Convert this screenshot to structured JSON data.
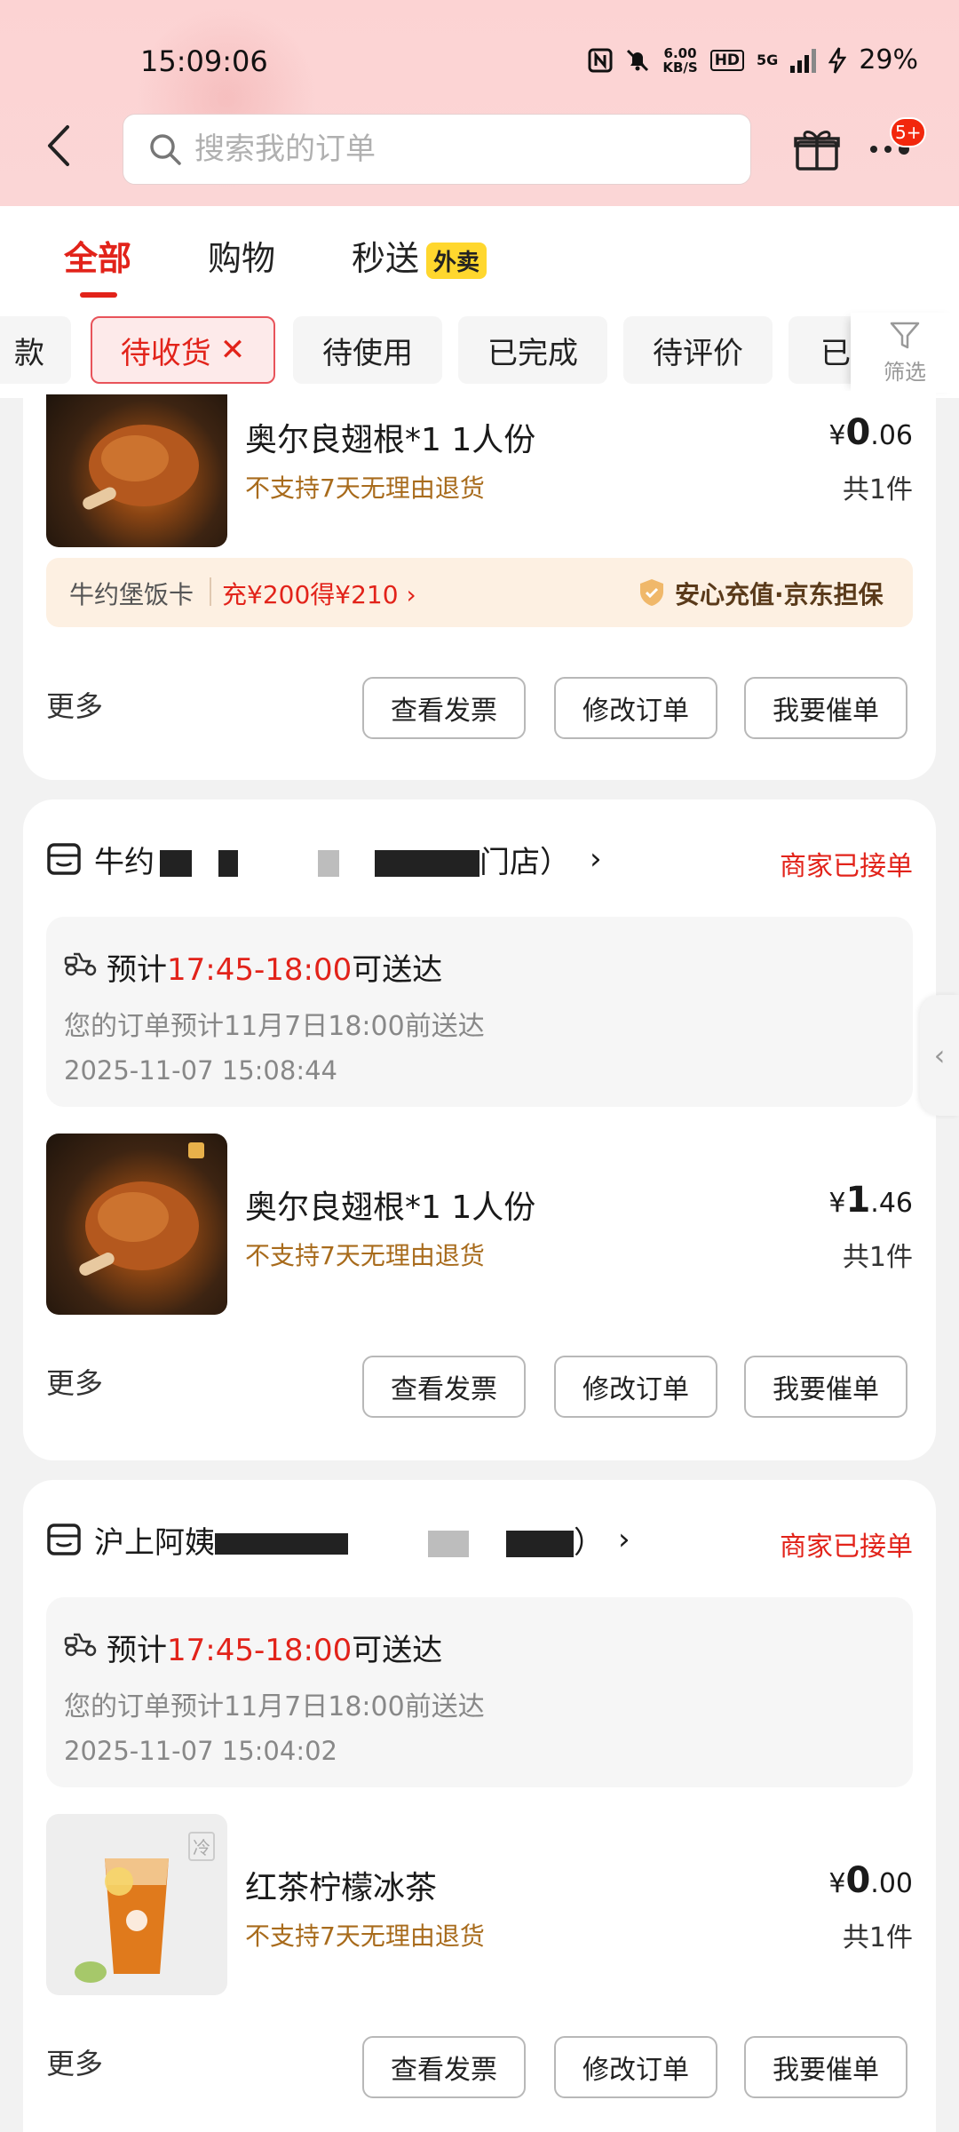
{
  "status_bar": {
    "time": "15:09:06",
    "net_speed_value": "6.00",
    "net_speed_unit": "KB/S",
    "hd": "HD",
    "network": "5G",
    "battery": "29%"
  },
  "header": {
    "search_placeholder": "搜索我的订单",
    "badge": "5+"
  },
  "main_tabs": [
    {
      "label": "全部",
      "active": true
    },
    {
      "label": "购物"
    },
    {
      "label": "秒送",
      "tag": "外卖"
    }
  ],
  "chips": [
    {
      "label": "款"
    },
    {
      "label": "待收货",
      "active": true,
      "close": "✕"
    },
    {
      "label": "待使用"
    },
    {
      "label": "已完成"
    },
    {
      "label": "待评价"
    },
    {
      "label": "已"
    }
  ],
  "filter_label": "筛选",
  "common": {
    "more": "更多",
    "view_invoice": "查看发票",
    "modify_order": "修改订单",
    "urge_order": "我要催单",
    "no_return": "不支持7天无理由退货",
    "count": "共1件",
    "currency": "¥"
  },
  "order1": {
    "item_name": "奥尔良翅根*1 1人份",
    "price_int": "0",
    "price_dec": ".06",
    "promo_card": "牛约堡饭卡",
    "promo_offer": "充¥200得¥210",
    "promo_guarantee": "安心充值·京东担保"
  },
  "order2": {
    "store_prefix": "牛约",
    "store_suffix": "门店）",
    "status": "商家已接单",
    "eta_prefix": "预计",
    "eta_time": "17:45-18:00",
    "eta_suffix": "可送达",
    "desc": "您的订单预计11月7日18:00前送达",
    "timestamp": "2025-11-07 15:08:44",
    "item_name": "奥尔良翅根*1 1人份",
    "price_int": "1",
    "price_dec": ".46"
  },
  "order3": {
    "store_prefix": "沪上阿姨",
    "store_suffix": "）",
    "status": "商家已接单",
    "eta_prefix": "预计",
    "eta_time": "17:45-18:00",
    "eta_suffix": "可送达",
    "desc": "您的订单预计11月7日18:00前送达",
    "timestamp": "2025-11-07 15:04:02",
    "item_name": "红茶柠檬冰茶",
    "cold_tag": "冷",
    "price_int": "0",
    "price_dec": ".00"
  },
  "colors": {
    "brand_red": "#e2231a",
    "header_pink": "#fcd3d3",
    "note_brown": "#a86b1c",
    "waimai_yellow": "#ffd72e"
  }
}
